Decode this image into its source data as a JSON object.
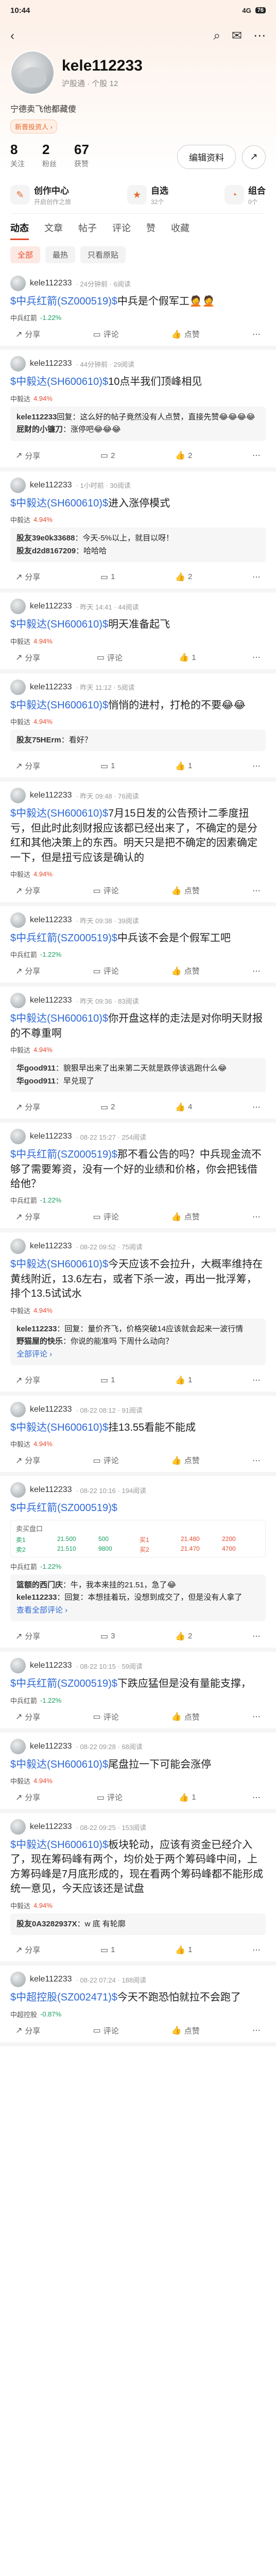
{
  "status_bar": {
    "time": "10:44",
    "signal": "4G",
    "battery": "76"
  },
  "profile": {
    "username": "kele112233",
    "sub": "沪股通 · 个股 12",
    "bio": "宁德卖飞他都藏傻",
    "badge": "新晋投资人 ›",
    "stats": [
      {
        "num": "8",
        "label": "关注"
      },
      {
        "num": "2",
        "label": "粉丝"
      },
      {
        "num": "67",
        "label": "获赞"
      }
    ],
    "edit_label": "编辑资料",
    "share_label": "↗"
  },
  "features": [
    {
      "title": "创作中心",
      "sub": "开启创作之旅"
    },
    {
      "title": "自选",
      "sub": "32个"
    },
    {
      "title": "组合",
      "sub": "0个"
    }
  ],
  "tabs": [
    "动态",
    "文章",
    "帖子",
    "评论",
    "赞",
    "收藏"
  ],
  "filters": [
    "全部",
    "最热",
    "只看原贴"
  ],
  "posts": [
    {
      "user": "kele112233",
      "meta": "· 24分钟前 · 6阅读",
      "body_link": "$中兵红箭(SZ000519)$",
      "body_text": "中兵是个假军工🤦🤦",
      "stock_name": "中兵红箭",
      "stock_pct": "-1.22%",
      "stock_up": false,
      "share": "分享",
      "comment": "评论",
      "like": "点赞",
      "liked": false,
      "comments": []
    },
    {
      "user": "kele112233",
      "meta": "· 44分钟前 · 29阅读",
      "body_link": "$中毅达(SH600610)$",
      "body_text": "10点半我们顶峰相见",
      "stock_name": "中毅达",
      "stock_pct": "4.94%",
      "stock_up": true,
      "share": "分享",
      "comment": "2",
      "like": "2",
      "liked": true,
      "comments": [
        {
          "user": "kele112233",
          "text": "回复：这么好的帖子竟然没有人点赞，直接先赞😂😂😂😂"
        },
        {
          "user": "屁财的小镰刀",
          "text": "：涨停吧😂😂😂"
        }
      ]
    },
    {
      "user": "kele112233",
      "meta": "· 1小时前 · 30阅读",
      "body_link": "$中毅达(SH600610)$",
      "body_text": "进入涨停模式",
      "stock_name": "中毅达",
      "stock_pct": "4.94%",
      "stock_up": true,
      "share": "分享",
      "comment": "1",
      "like": "2",
      "liked": true,
      "comments": [
        {
          "user": "股友39e0k33688",
          "text": "：今天-5%以上，就目以呀！"
        },
        {
          "user": "股友d2d8167209",
          "text": "：哈哈哈"
        }
      ]
    },
    {
      "user": "kele112233",
      "meta": "· 昨天 14:41 · 44阅读",
      "body_link": "$中毅达(SH600610)$",
      "body_text": "明天准备起飞",
      "stock_name": "中毅达",
      "stock_pct": "4.94%",
      "stock_up": true,
      "share": "分享",
      "comment": "评论",
      "like": "1",
      "liked": true,
      "comments": []
    },
    {
      "user": "kele112233",
      "meta": "· 昨天 11:12 · 5阅读",
      "body_link": "$中毅达(SH600610)$",
      "body_text": "悄悄的进村，打枪的不要😂😂",
      "stock_name": "中毅达",
      "stock_pct": "4.94%",
      "stock_up": true,
      "share": "分享",
      "comment": "1",
      "like": "1",
      "liked": true,
      "comments": [
        {
          "user": "股友75HErm",
          "text": "：看好？"
        }
      ]
    },
    {
      "user": "kele112233",
      "meta": "· 昨天 09:48 · 76阅读",
      "body_link": "$中毅达(SH600610)$",
      "body_text": "7月15日发的公告预计二季度扭亏，但此时此刻财报应该都已经出来了，不确定的是分红和其他决策上的东西。明天只是把不确定的因素确定一下，但是扭亏应该是确认的",
      "stock_name": "中毅达",
      "stock_pct": "4.94%",
      "stock_up": true,
      "share": "分享",
      "comment": "评论",
      "like": "点赞",
      "liked": false,
      "comments": []
    },
    {
      "user": "kele112233",
      "meta": "· 昨天 09:38 · 39阅读",
      "body_link": "$中兵红箭(SZ000519)$",
      "body_text": "中兵该不会是个假军工吧",
      "stock_name": "中兵红箭",
      "stock_pct": "-1.22%",
      "stock_up": false,
      "share": "分享",
      "comment": "评论",
      "like": "点赞",
      "liked": false,
      "comments": []
    },
    {
      "user": "kele112233",
      "meta": "· 昨天 09:36 · 83阅读",
      "body_link": "$中毅达(SH600610)$",
      "body_text": "你开盘这样的走法是对你明天财报的不尊重啊",
      "stock_name": "中毅达",
      "stock_pct": "4.94%",
      "stock_up": true,
      "share": "分享",
      "comment": "2",
      "like": "4",
      "liked": true,
      "comments": [
        {
          "user": "华good911",
          "text": "：貌狠早出来了出来第二天就是跌停该逃跑什么😂"
        },
        {
          "user": "华good911",
          "text": "：早兑现了"
        }
      ]
    },
    {
      "user": "kele112233",
      "meta": "· 08-22 15:27 · 254阅读",
      "body_link": "$中兵红箭(SZ000519)$",
      "body_text": "那不看公告的吗？中兵现金流不够了需要筹资，没有一个好的业绩和价格，你会把钱借给他？",
      "stock_name": "中兵红箭",
      "stock_pct": "-1.22%",
      "stock_up": false,
      "share": "分享",
      "comment": "评论",
      "like": "点赞",
      "liked": false,
      "comments": []
    },
    {
      "user": "kele112233",
      "meta": "· 08-22 09:52 · 75阅读",
      "body_link": "$中毅达(SH600610)$",
      "body_text": "今天应该不会拉升，大概率维持在黄线附近，13.6左右，或者下杀一波，再出一批浮筹，排个13.5试试水",
      "stock_name": "中毅达",
      "stock_pct": "4.94%",
      "stock_up": true,
      "share": "分享",
      "comment": "1",
      "like": "1",
      "liked": true,
      "comments": [
        {
          "user": "kele112233",
          "text": "：回复：量价齐飞，价格突破14应该就会起来一波行情"
        },
        {
          "user": "野猫屋的快乐",
          "text": "：你说的能准吗 下周什么动向？"
        },
        {
          "user": "",
          "text": "全部评论 ›"
        }
      ]
    },
    {
      "user": "kele112233",
      "meta": "· 08-22 08:12 · 91阅读",
      "body_link": "$中毅达(SH600610)$",
      "body_text": "挂13.55看能不能成",
      "stock_name": "中毅达",
      "stock_pct": "4.94%",
      "stock_up": true,
      "share": "分享",
      "comment": "评论",
      "like": "点赞",
      "liked": false,
      "comments": []
    },
    {
      "user": "kele112233",
      "meta": "· 08-22 10:16 · 194阅读",
      "body_link": "$中兵红箭(SZ000519)$",
      "body_text": "",
      "stock_name": "中兵红箭",
      "stock_pct": "-1.22%",
      "stock_up": false,
      "share": "分享",
      "comment": "3",
      "like": "2",
      "liked": true,
      "order_book": {
        "title": "卖买盘口",
        "rows": [
          [
            "卖1",
            "21.500",
            "500",
            "买1",
            "21.480",
            "2200"
          ],
          [
            "卖2",
            "21.510",
            "9800",
            "买2",
            "21.470",
            "4700"
          ]
        ]
      },
      "comments": [
        {
          "user": "篮额的西门庆",
          "text": "：牛，我本来挂的21.51，急了😂"
        },
        {
          "user": "kele112233",
          "text": "：回复：本想挂着玩，没想到成交了，但是没有人拿了"
        },
        {
          "user": "",
          "text": "查看全部评论 ›"
        }
      ]
    },
    {
      "user": "kele112233",
      "meta": "· 08-22 10:15 · 59阅读",
      "body_link": "$中兵红箭(SZ000519)$",
      "body_text": "下跌应猛但是没有量能支撑，",
      "stock_name": "中兵红箭",
      "stock_pct": "-1.22%",
      "stock_up": false,
      "share": "分享",
      "comment": "评论",
      "like": "点赞",
      "liked": false,
      "comments": []
    },
    {
      "user": "kele112233",
      "meta": "· 08-22 09:28 · 68阅读",
      "body_link": "$中毅达(SH600610)$",
      "body_text": "尾盘拉一下可能会涨停",
      "stock_name": "中毅达",
      "stock_pct": "4.94%",
      "stock_up": true,
      "share": "分享",
      "comment": "评论",
      "like": "1",
      "liked": true,
      "comments": []
    },
    {
      "user": "kele112233",
      "meta": "· 08-22 09:25 · 153阅读",
      "body_link": "$中毅达(SH600610)$",
      "body_text": "板块轮动，应该有资金已经介入了，现在筹码峰有两个，均价处于两个筹码峰中间，上方筹码峰是7月底形成的，现在看两个筹码峰都不能形成统一意见，今天应该还是试盘",
      "stock_name": "中毅达",
      "stock_pct": "4.94%",
      "stock_up": true,
      "share": "分享",
      "comment": "1",
      "like": "1",
      "liked": true,
      "comments": [
        {
          "user": "股友0A3282937X",
          "text": "：w 底 有轮廓"
        }
      ]
    },
    {
      "user": "kele112233",
      "meta": "· 08-22 07:24 · 188阅读",
      "body_link": "$中超控股(SZ002471)$",
      "body_text": "今天不跑恐怕就拉不会跑了",
      "stock_name": "中超控股",
      "stock_pct": "-0.87%",
      "stock_up": false,
      "share": "分享",
      "comment": "评论",
      "like": "点赞",
      "liked": false,
      "comments": []
    }
  ]
}
